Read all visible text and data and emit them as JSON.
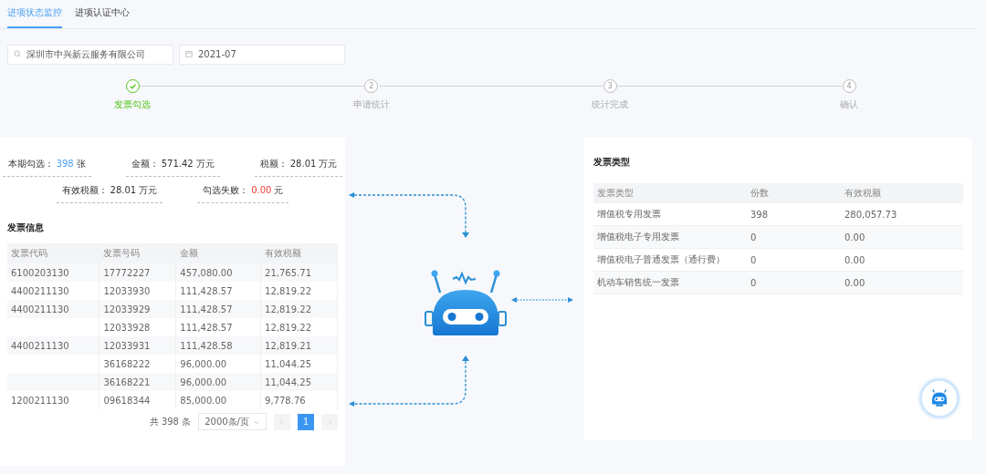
{
  "tabs": [
    {
      "label": "进项状态监控",
      "selected": true
    },
    {
      "label": "进项认证中心",
      "selected": false
    }
  ],
  "filters": {
    "company": "深圳市中兴新云服务有限公司",
    "period": "2021-07"
  },
  "steps": [
    {
      "label": "发票勾选",
      "done": true
    },
    {
      "label": "申请统计",
      "done": false,
      "number": "2"
    },
    {
      "label": "统计完成",
      "done": false,
      "number": "3"
    },
    {
      "label": "确认",
      "done": false,
      "number": "4"
    }
  ],
  "summary": {
    "rows": [
      [
        {
          "label": "本期勾选：",
          "value": "398",
          "unit": "张",
          "color": "#4a9ff5"
        },
        {
          "label": "金额：",
          "value": "571.42",
          "unit": "万元",
          "color": "#333333"
        },
        {
          "label": "税额：",
          "value": "28.01",
          "unit": "万元",
          "color": "#333333"
        }
      ],
      [
        {
          "label": "有效税额：",
          "value": "28.01",
          "unit": "万元",
          "color": "#333333"
        },
        {
          "label": "勾选失败：",
          "value": "0.00",
          "unit": "元",
          "color": "#f23b3b"
        }
      ]
    ]
  },
  "invoice_info": {
    "title": "发票信息",
    "columns": [
      "发票代码",
      "发票号码",
      "金额",
      "有效税额"
    ],
    "rows": [
      {
        "code": "6100203130",
        "number": "17772227",
        "amount": "457,080.00",
        "tax": "21,765.71"
      },
      {
        "code": "4400211130",
        "number": "12033930",
        "amount": "111,428.57",
        "tax": "12,819.22"
      },
      {
        "code": "4400211130",
        "number": "12033929",
        "amount": "111,428.57",
        "tax": "12,819.22"
      },
      {
        "number": "12033928",
        "amount": "111,428.57",
        "tax": "12,819.22"
      },
      {
        "code": "4400211130",
        "number": "12033931",
        "amount": "111,428.58",
        "tax": "12,819.21"
      },
      {
        "number": "36168222",
        "amount": "96,000.00",
        "tax": "11,044.25"
      },
      {
        "number": "36168221",
        "amount": "96,000.00",
        "tax": "11,044.25"
      },
      {
        "code": "1200211130",
        "number": "09618344",
        "amount": "85,000.00",
        "tax": "9,778.76"
      }
    ],
    "pagination": {
      "total": "共 398 条",
      "page_size": "2000条/页",
      "pages": [
        {
          "label": "1",
          "selected": true
        }
      ]
    }
  },
  "invoice_types": {
    "title": "发票类型",
    "columns": [
      "发票类型",
      "份数",
      "有效税额"
    ],
    "rows": [
      [
        "增值税专用发票",
        "398",
        "280,057.73"
      ],
      [
        "增值税电子专用发票",
        "0",
        "0.00"
      ],
      [
        "增值税电子普通发票（通行费）",
        "0",
        "0.00"
      ],
      [
        "机动车销售统一发票",
        "0",
        "0.00"
      ]
    ]
  }
}
